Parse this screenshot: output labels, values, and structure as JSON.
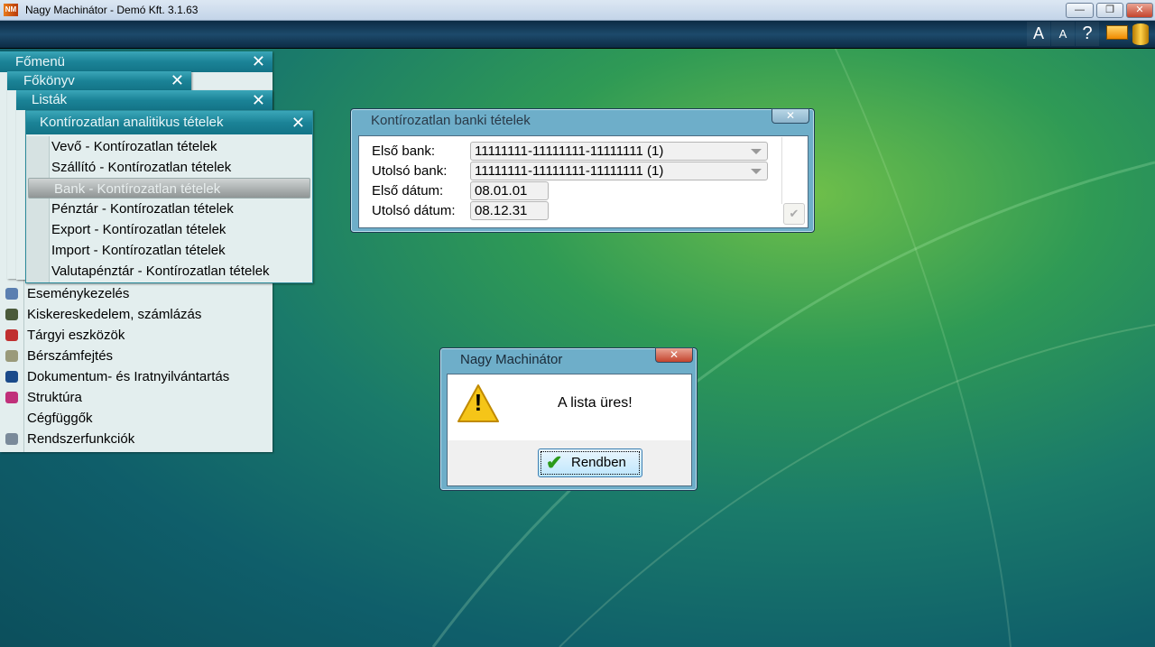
{
  "window": {
    "title": "Nagy Machinátor - Demó Kft. 3.1.63",
    "app_icon": "NM",
    "minimize": "—",
    "restore": "❐",
    "close": "✕"
  },
  "toolbar": {
    "font_larger": "A",
    "font_smaller": "A",
    "help": "?",
    "monitor_icon": "monitor-icon",
    "database_icon": "database-icon"
  },
  "panels": {
    "fomenu": {
      "title": "Főmenü",
      "close": "✕",
      "items": [
        {
          "label": "Eseménykezelés"
        },
        {
          "label": "Kiskereskedelem, számlázás"
        },
        {
          "label": "Tárgyi eszközök"
        },
        {
          "label": "Bérszámfejtés"
        },
        {
          "label": "Dokumentum- és Iratnyilvántartás"
        },
        {
          "label": "Struktúra"
        },
        {
          "label": "Cégfüggők"
        },
        {
          "label": "Rendszerfunkciók"
        }
      ]
    },
    "fokonyv": {
      "title": "Főkönyv",
      "close": "✕"
    },
    "listak": {
      "title": "Listák",
      "close": "✕"
    },
    "kontir": {
      "title": "Kontírozatlan analitikus tételek",
      "close": "✕",
      "selected_index": 2,
      "items": [
        {
          "label": "Vevő - Kontírozatlan tételek"
        },
        {
          "label": "Szállító - Kontírozatlan tételek"
        },
        {
          "label": "Bank - Kontírozatlan tételek"
        },
        {
          "label": "Pénztár - Kontírozatlan tételek"
        },
        {
          "label": "Export - Kontírozatlan tételek"
        },
        {
          "label": "Import - Kontírozatlan tételek"
        },
        {
          "label": "Valutapénztár - Kontírozatlan tételek"
        }
      ]
    }
  },
  "bank_dialog": {
    "title": "Kontírozatlan banki tételek",
    "close": "✕",
    "first_bank_label": "Első bank:",
    "first_bank_value": "11111111-11111111-11111111 (1)",
    "last_bank_label": "Utolsó bank:",
    "last_bank_value": "11111111-11111111-11111111 (1)",
    "first_date_label": "Első dátum:",
    "first_date_value": "08.01.01",
    "last_date_label": "Utolsó dátum:",
    "last_date_value": "08.12.31",
    "ok": "✔"
  },
  "message": {
    "title": "Nagy Machinátor",
    "close": "✕",
    "text": "A lista üres!",
    "ok_label": "Rendben",
    "warn": "!"
  }
}
